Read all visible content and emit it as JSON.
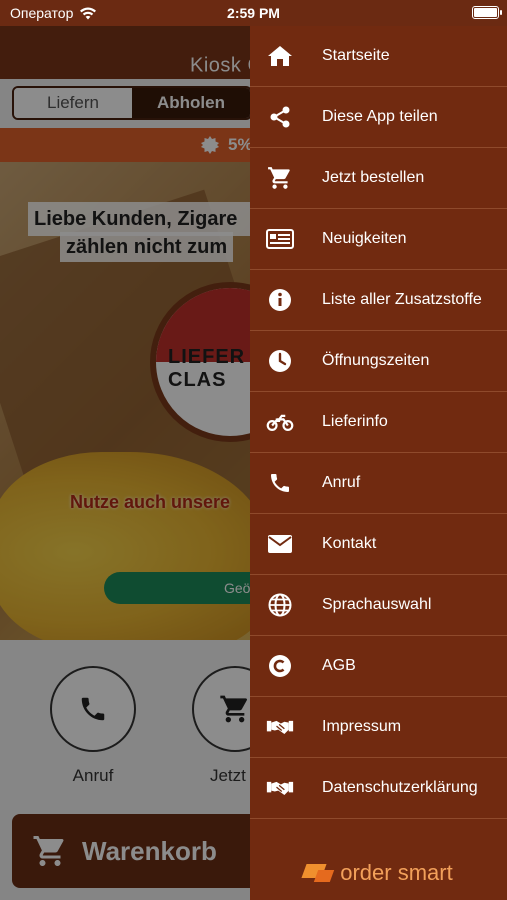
{
  "status_bar": {
    "carrier": "Оператор",
    "time": "2:59 PM"
  },
  "app": {
    "header_title": "Kiosk C",
    "tabs": {
      "left": "Liefern",
      "right": "Abholen"
    },
    "promo": "5%",
    "hero": {
      "notice_line1": "Liebe Kunden, Zigare",
      "notice_line2": "zählen nicht zum",
      "logo_text": "LIEFER CLAS",
      "slogan": "Nutze auch unsere",
      "green_button": "Geö"
    },
    "quick_actions": [
      {
        "label": "Anruf",
        "icon": "phone-icon"
      },
      {
        "label": "Jetzt b",
        "icon": "cart-icon"
      }
    ],
    "cart_label": "Warenkorb"
  },
  "drawer": {
    "items": [
      {
        "label": "Startseite",
        "icon": "home-icon"
      },
      {
        "label": "Diese App teilen",
        "icon": "share-icon"
      },
      {
        "label": "Jetzt bestellen",
        "icon": "cart-icon"
      },
      {
        "label": "Neuigkeiten",
        "icon": "news-icon"
      },
      {
        "label": "Liste aller Zusatzstoffe",
        "icon": "info-icon"
      },
      {
        "label": "Öffnungszeiten",
        "icon": "clock-icon"
      },
      {
        "label": "Lieferinfo",
        "icon": "motorcycle-icon"
      },
      {
        "label": "Anruf",
        "icon": "phone-icon"
      },
      {
        "label": "Kontakt",
        "icon": "mail-icon"
      },
      {
        "label": "Sprachauswahl",
        "icon": "globe-icon"
      },
      {
        "label": "AGB",
        "icon": "copyright-icon"
      },
      {
        "label": "Impressum",
        "icon": "handshake-icon"
      },
      {
        "label": "Datenschutzerklärung",
        "icon": "handshake-icon"
      }
    ],
    "brand": "order smart"
  },
  "colors": {
    "drawer_bg": "#712a10",
    "header_bg": "#7a3518",
    "promo_bg": "#e0622a",
    "brand": "#f2a05a"
  }
}
